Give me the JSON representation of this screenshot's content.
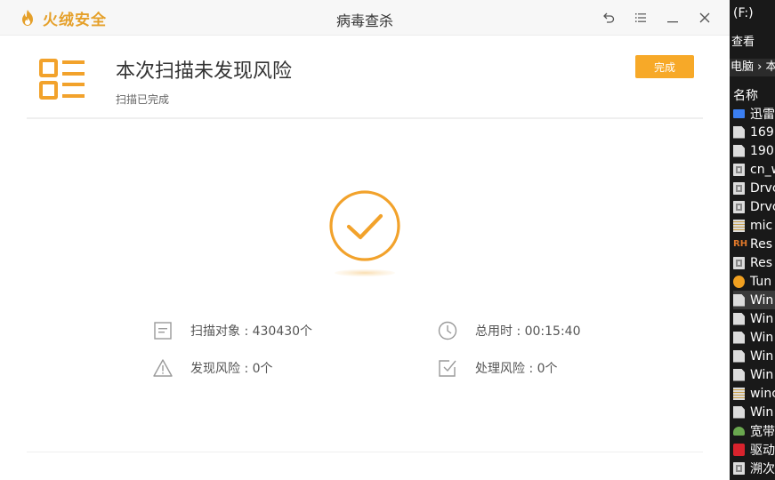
{
  "dialog": {
    "brand_name": "火绒安全",
    "window_title": "病毒查杀",
    "icons": {
      "brand": "flame-logo-icon",
      "back": "back-arrow-icon",
      "menu": "menu-icon",
      "minimize": "minimize-icon",
      "close": "close-icon",
      "report": "report-list-icon",
      "status": "check-circle-icon"
    }
  },
  "result": {
    "title": "本次扫描未发现风险",
    "subtitle": "扫描已完成",
    "done_label": "完成"
  },
  "stats": [
    {
      "text": "扫描对象 : 430430个",
      "icon": "document-icon"
    },
    {
      "text": "总用时 : 00:15:40",
      "icon": "clock-icon"
    },
    {
      "text": "发现风险 : 0个",
      "icon": "warning-icon"
    },
    {
      "text": "处理风险 : 0个",
      "icon": "check-square-icon"
    }
  ],
  "explorer": {
    "drive": "(F:)",
    "view": "查看",
    "path": "电脑 › 本",
    "column": "名称",
    "items": [
      {
        "label": "迅雷",
        "icon": "folder-icon",
        "color": "#3b7ff2"
      },
      {
        "label": "169",
        "icon": "file-icon",
        "color": "#dcdcdc"
      },
      {
        "label": "190",
        "icon": "file-icon",
        "color": "#dcdcdc"
      },
      {
        "label": "cn_w",
        "icon": "disc-image-icon",
        "color": "#dcdcdc"
      },
      {
        "label": "Drvc",
        "icon": "disc-image-icon",
        "color": "#dcdcdc"
      },
      {
        "label": "Drvc",
        "icon": "disc-image-icon",
        "color": "#dcdcdc"
      },
      {
        "label": "mic",
        "icon": "archive-icon",
        "color": "#dcdcdc"
      },
      {
        "label": "Res",
        "icon": "resource-hacker-icon",
        "color": "#e0782a"
      },
      {
        "label": "Res",
        "icon": "disc-image-icon",
        "color": "#dcdcdc"
      },
      {
        "label": "Tun",
        "icon": "app-icon",
        "color": "#f0a020"
      },
      {
        "label": "Win",
        "icon": "file-icon",
        "color": "#dcdcdc"
      },
      {
        "label": "Win",
        "icon": "file-icon",
        "color": "#dcdcdc"
      },
      {
        "label": "Win",
        "icon": "file-icon",
        "color": "#dcdcdc"
      },
      {
        "label": "Win",
        "icon": "file-icon",
        "color": "#dcdcdc"
      },
      {
        "label": "Win",
        "icon": "file-icon",
        "color": "#dcdcdc"
      },
      {
        "label": "winc",
        "icon": "archive-icon",
        "color": "#dcdcdc"
      },
      {
        "label": "Win",
        "icon": "file-icon",
        "color": "#dcdcdc"
      },
      {
        "label": "宽带",
        "icon": "network-icon",
        "color": "#6aa84f"
      },
      {
        "label": "驱动",
        "icon": "driver-app-icon",
        "color": "#d9232d"
      },
      {
        "label": "溯次",
        "icon": "disc-image-icon",
        "color": "#dcdcdc"
      }
    ],
    "selected_index": 10
  },
  "colors": {
    "accent": "#f7a928",
    "brand": "#e5a02a",
    "text_dark": "#333333",
    "text_muted": "#666666"
  }
}
